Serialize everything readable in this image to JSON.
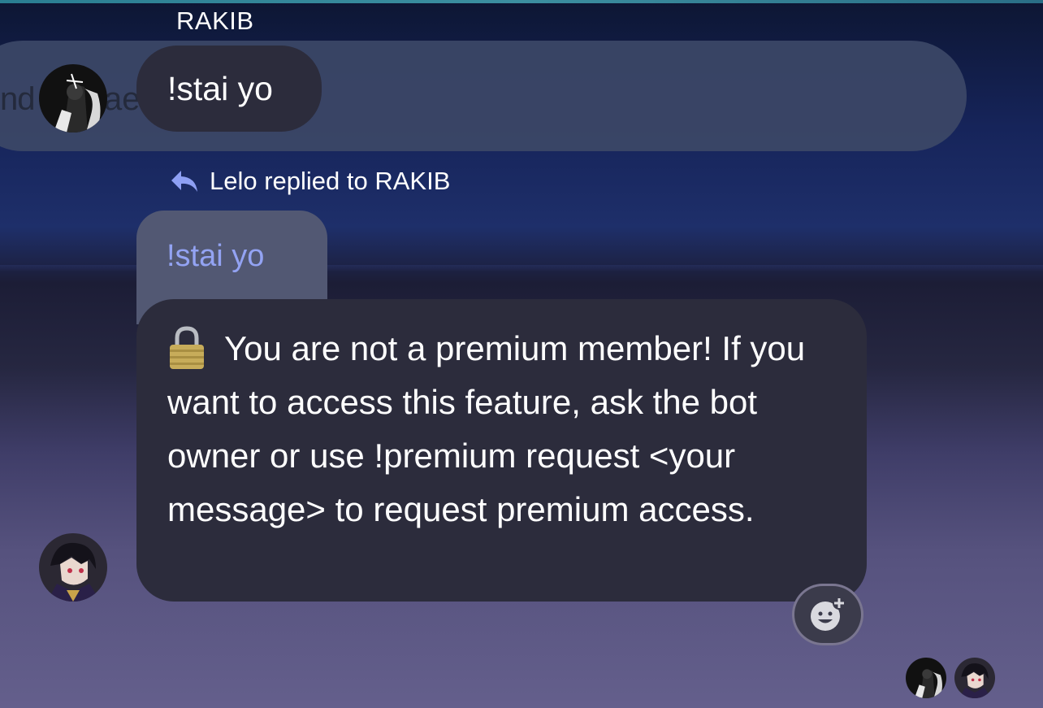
{
  "messages": [
    {
      "sender": "RAKIB",
      "text": "!stai yo"
    },
    {
      "reply_header": "Lelo replied to RAKIB",
      "quoted_text": "!stai yo",
      "text": "You are not a premium member! If you want to access this feature, ask the bot owner or use !premium request <your message> to request premium access.",
      "leading_icon": "lock-icon"
    }
  ],
  "background_partial_text": [
    "nd",
    "ae"
  ],
  "colors": {
    "bubble": "#2c2c3c",
    "quote_bubble": "#525873",
    "quote_text": "#93a3f3",
    "reply_icon": "#8ea0f4"
  },
  "icons": [
    "reply-arrow-icon",
    "lock-icon",
    "add-reaction-icon"
  ]
}
